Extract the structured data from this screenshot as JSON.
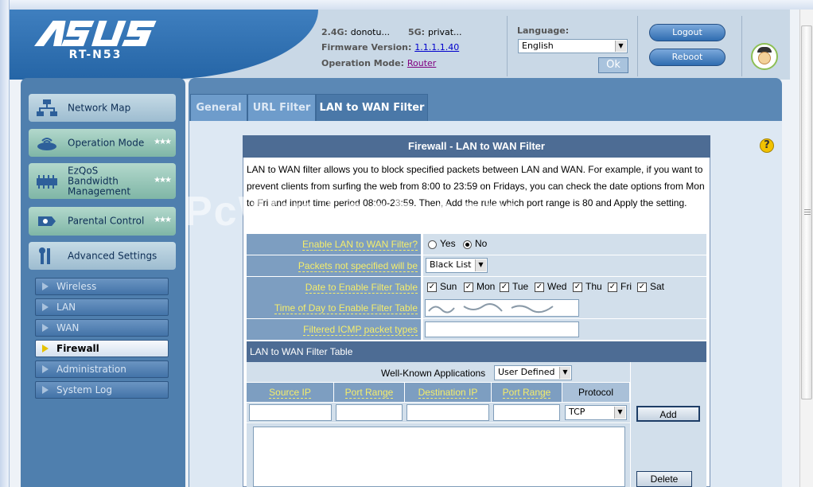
{
  "header": {
    "logo": "/ISUS",
    "model": "RT-N53",
    "ssid_24_label": "2.4G:",
    "ssid_24_value": "donotu...",
    "ssid_5_label": "5G:",
    "ssid_5_value": "privat...",
    "firmware_label": "Firmware Version:",
    "firmware_value": "1.1.1.1.40",
    "opmode_label": "Operation Mode:",
    "opmode_value": "Router",
    "language_label": "Language:",
    "language_value": "English",
    "ok_label": "Ok",
    "logout_label": "Logout",
    "reboot_label": "Reboot"
  },
  "sidebar": {
    "items": [
      {
        "label": "Network Map",
        "icon": "network-map-icon"
      },
      {
        "label": "Operation Mode",
        "icon": "router-icon"
      },
      {
        "label": "EzQoS\nBandwidth\nManagement",
        "icon": "qos-icon"
      },
      {
        "label": "Parental Control",
        "icon": "parental-icon"
      },
      {
        "label": "Advanced Settings",
        "icon": "tools-icon"
      }
    ],
    "submenu": [
      "Wireless",
      "LAN",
      "WAN",
      "Firewall",
      "Administration",
      "System Log"
    ],
    "active_submenu": "Firewall"
  },
  "tabs": [
    {
      "label": "General"
    },
    {
      "label": "URL Filter"
    },
    {
      "label": "LAN to WAN Filter",
      "active": true
    }
  ],
  "panel": {
    "title": "Firewall - LAN to WAN Filter",
    "description": "LAN to WAN filter allows you to block specified packets between LAN and WAN. For example, if you want to prevent clients from surfing the web from 8:00 to 23:59 on Fridays, you can check the date options from Mon to Fri and input time period 08:00-23:59. Then, Add the rule which port range is 80 and Apply the setting.",
    "watermark": "PcWinTech.com"
  },
  "form": {
    "enable_label": "Enable LAN to WAN Filter?",
    "enable_yes": "Yes",
    "enable_no": "No",
    "enable_value": "No",
    "packets_label": "Packets not specified will be",
    "packets_value": "Black List",
    "date_label": "Date to Enable Filter Table",
    "days": [
      "Sun",
      "Mon",
      "Tue",
      "Wed",
      "Thu",
      "Fri",
      "Sat"
    ],
    "time_label": "Time of Day to Enable Filter Table",
    "icmp_label": "Filtered ICMP packet types",
    "icmp_value": ""
  },
  "filter_table": {
    "title": "LAN to WAN Filter Table",
    "wellknown_label": "Well-Known Applications",
    "wellknown_value": "User Defined",
    "columns": [
      "Source IP",
      "Port Range",
      "Destination IP",
      "Port Range",
      "Protocol"
    ],
    "protocol_value": "TCP",
    "add_label": "Add",
    "delete_label": "Delete"
  }
}
